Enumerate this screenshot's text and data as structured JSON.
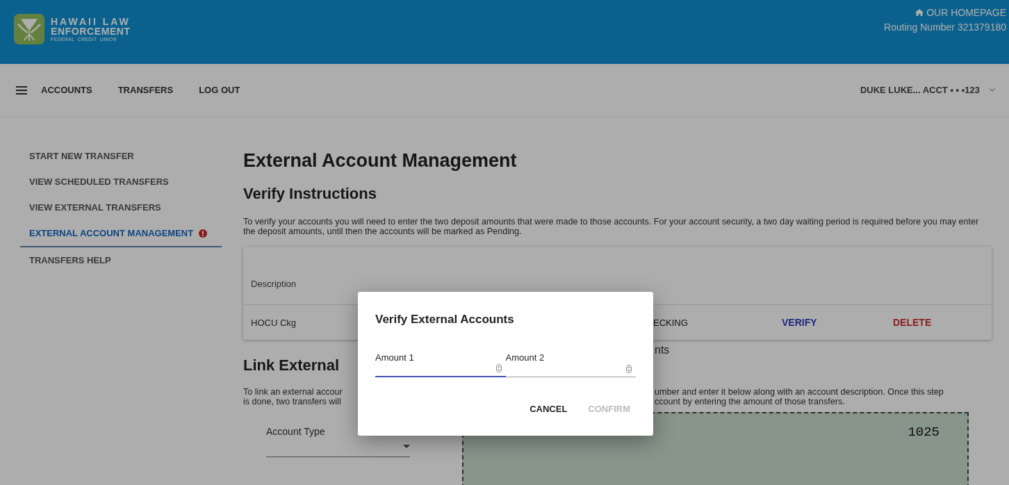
{
  "header": {
    "logo": {
      "line1": "HAWAII LAW",
      "line2": "ENFORCEMENT",
      "line3": "FEDERAL  CREDIT  UNION"
    },
    "homepage_link": "OUR HOMEPAGE",
    "routing": "Routing Number 321379180"
  },
  "nav": {
    "items": [
      "ACCOUNTS",
      "TRANSFERS",
      "LOG OUT"
    ],
    "account": "DUKE LUKE...  ACCT • • •123"
  },
  "sidebar": {
    "items": [
      {
        "label": "START NEW TRANSFER",
        "selected": false,
        "alert": false
      },
      {
        "label": "VIEW SCHEDULED TRANSFERS",
        "selected": false,
        "alert": false
      },
      {
        "label": "VIEW EXTERNAL TRANSFERS",
        "selected": false,
        "alert": false
      },
      {
        "label": "EXTERNAL ACCOUNT MANAGEMENT",
        "selected": true,
        "alert": true
      },
      {
        "label": "TRANSFERS HELP",
        "selected": false,
        "alert": false
      }
    ]
  },
  "main": {
    "title": "External Account Management",
    "verify_heading": "Verify Instructions",
    "verify_text": "To verify your accounts you will need to enter the two deposit amounts that were made to those accounts. For your account security, a two day waiting period is required before you may enter the deposit amounts, until then the accounts will be marked as Pending.",
    "table": {
      "columns": [
        "Description"
      ],
      "rows": [
        {
          "description": "HOCU Ckg",
          "type": "ECKING",
          "verify": "VERIFY",
          "delete": "DELETE"
        }
      ]
    },
    "link_heading": "Link External",
    "right_fragment": "nts",
    "link_text_left": [
      "To link an external accour",
      "is done, two transfers will"
    ],
    "link_text_right": [
      "umber and enter it below along with an account description. Once this step",
      "ccount by entering the amount of those transfers."
    ],
    "account_type": {
      "label": "Account Type"
    },
    "check": {
      "number": "1025"
    }
  },
  "dialog": {
    "title": "Verify External Accounts",
    "fields": [
      {
        "label": "Amount 1",
        "focused": true
      },
      {
        "label": "Amount 2",
        "focused": false
      }
    ],
    "buttons": [
      {
        "label": "CANCEL",
        "disabled": false
      },
      {
        "label": "CONFIRM",
        "disabled": true
      }
    ]
  }
}
